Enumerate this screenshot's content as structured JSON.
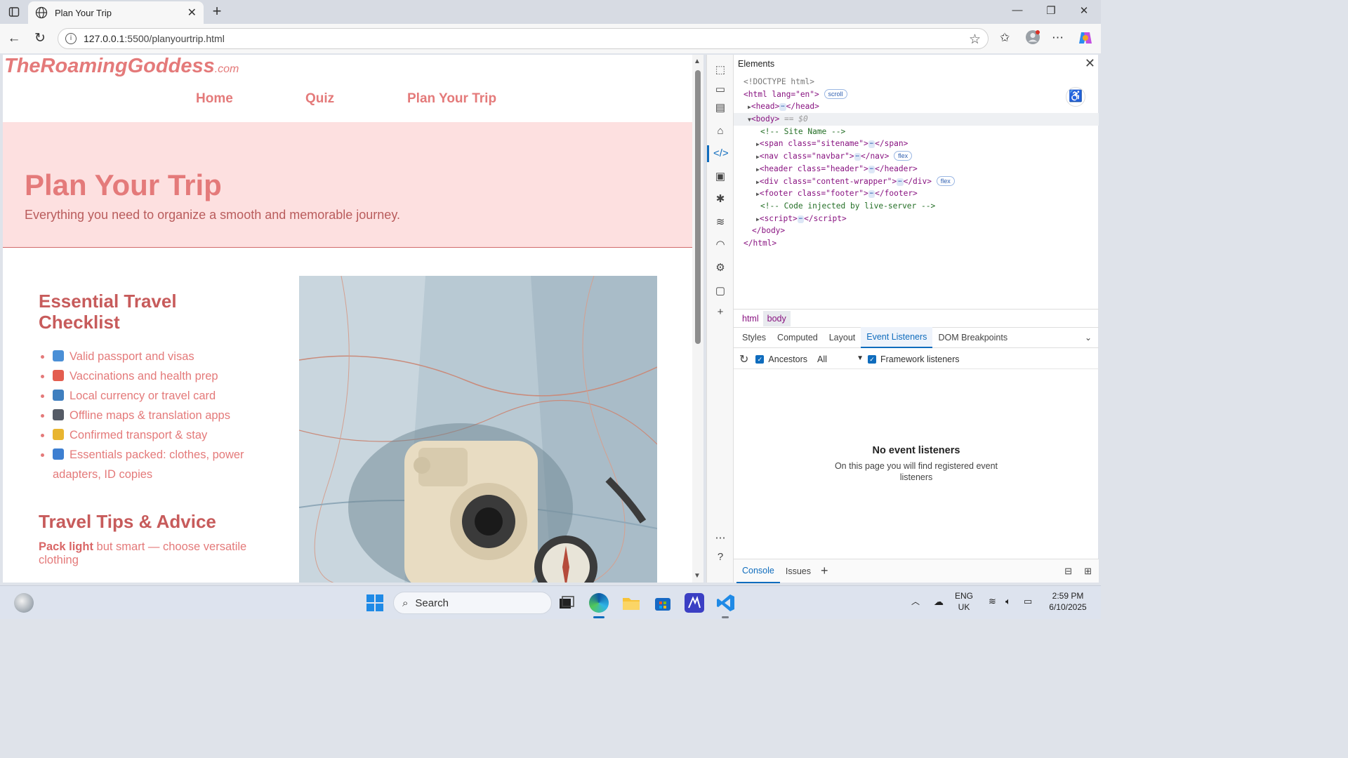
{
  "browser": {
    "tab_title": "Plan Your Trip",
    "url_host": "127.0.0.1",
    "url_path": ":5500/planyourtrip.html"
  },
  "page": {
    "sitename": "TheRoamingGoddess",
    "sitename_suffix": ".com",
    "nav": [
      "Home",
      "Quiz",
      "Plan Your Trip"
    ],
    "hero_title": "Plan Your Trip",
    "hero_subtitle": "Everything you need to organize a smooth and memorable journey.",
    "checklist_title": "Essential Travel Checklist",
    "checklist": [
      {
        "icon": "passport-icon",
        "color": "#4a8fd6",
        "text": "Valid passport and visas"
      },
      {
        "icon": "pill-icon",
        "color": "#e35d4f",
        "text": "Vaccinations and health prep"
      },
      {
        "icon": "credit-card-icon",
        "color": "#3f7fbf",
        "text": "Local currency or travel card"
      },
      {
        "icon": "phone-icon",
        "color": "#555b66",
        "text": "Offline maps & translation apps"
      },
      {
        "icon": "ticket-icon",
        "color": "#e8b530",
        "text": "Confirmed transport & stay"
      },
      {
        "icon": "luggage-icon",
        "color": "#3d7fd1",
        "text": "Essentials packed: clothes, power adapters, ID copies"
      }
    ],
    "tips_title": "Travel Tips & Advice",
    "tip_bold": "Pack light",
    "tip_rest": " but smart — choose versatile clothing"
  },
  "devtools": {
    "panel_title": "Elements",
    "dom": {
      "doctype": "<!DOCTYPE html>",
      "html_open": "<html lang=\"en\">",
      "html_badge": "scroll",
      "head": "<head>",
      "body_marker": "== $0",
      "comment_site": "<!-- Site Name -->",
      "span": "<span class=\"sitename\">",
      "nav": "<nav class=\"navbar\">",
      "nav_badge": "flex",
      "header": "<header class=\"header\">",
      "div": "<div class=\"content-wrapper\">",
      "div_badge": "flex",
      "footer": "<footer class=\"footer\">",
      "comment_live": "<!-- Code injected by live-server -->",
      "script": "<script>",
      "body_close": "</body>",
      "html_close": "</html>"
    },
    "breadcrumbs": [
      "html",
      "body"
    ],
    "tabs": [
      "Styles",
      "Computed",
      "Layout",
      "Event Listeners",
      "DOM Breakpoints"
    ],
    "active_tab": "Event Listeners",
    "ancestors_label": "Ancestors",
    "filter_value": "All",
    "framework_label": "Framework listeners",
    "empty_title": "No event listeners",
    "empty_desc": "On this page you will find registered event listeners",
    "drawer_tabs": [
      "Console",
      "Issues"
    ]
  },
  "taskbar": {
    "search_placeholder": "Search",
    "lang_top": "ENG",
    "lang_bottom": "UK",
    "time": "2:59 PM",
    "date": "6/10/2025"
  }
}
